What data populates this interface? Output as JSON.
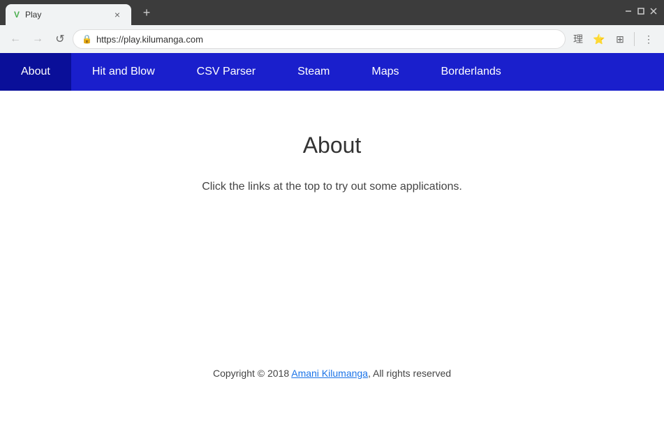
{
  "browser": {
    "tab_title": "Play",
    "tab_favicon": "V",
    "url": "https://play.kilumanga.com",
    "new_tab_label": "+",
    "close_label": "×"
  },
  "window_controls": {
    "minimize_label": "—",
    "maximize_label": "□",
    "close_label": "✕"
  },
  "toolbar": {
    "back_label": "←",
    "forward_label": "→",
    "reload_label": "↺",
    "lock_label": "🔒",
    "address": "https://play.kilumanga.com"
  },
  "toolbar_icons": {
    "translate_label": "理",
    "extension_label": "⊞",
    "menu_label": "⋮"
  },
  "nav": {
    "items": [
      {
        "label": "About",
        "active": true
      },
      {
        "label": "Hit and Blow",
        "active": false
      },
      {
        "label": "CSV Parser",
        "active": false
      },
      {
        "label": "Steam",
        "active": false
      },
      {
        "label": "Maps",
        "active": false
      },
      {
        "label": "Borderlands",
        "active": false
      }
    ]
  },
  "page": {
    "title": "About",
    "description": "Click the links at the top to try out some applications."
  },
  "footer": {
    "prefix_text": "Copyright © 2018 ",
    "link_text": "Amani Kilumanga",
    "suffix_text": ", All rights reserved"
  }
}
